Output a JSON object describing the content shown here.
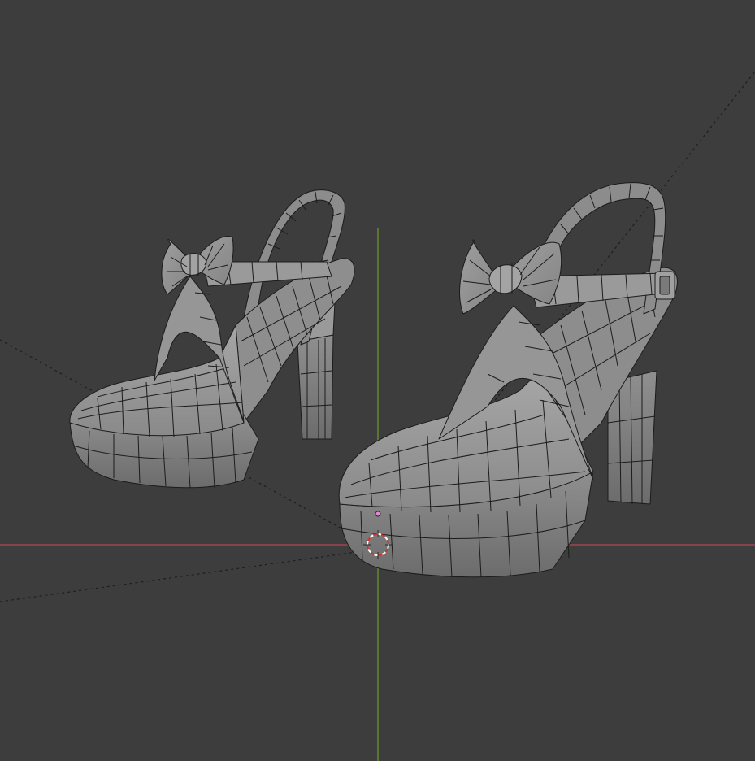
{
  "viewport": {
    "background": "#3d3d3d",
    "grid_color": "#454545",
    "x_axis_color": "#b14a55",
    "y_axis_color": "#6b9b2a",
    "mesh_fill": "#8f8f8f",
    "mesh_light": "#a9a9a9",
    "mesh_dark": "#6f6f6f",
    "wire_color": "#1c1c1c"
  },
  "objects": [
    {
      "name": "left-shoe"
    },
    {
      "name": "right-shoe"
    }
  ],
  "cursor_3d": {
    "visible": true
  },
  "origin_marker": {
    "color": "#e28ad6"
  }
}
